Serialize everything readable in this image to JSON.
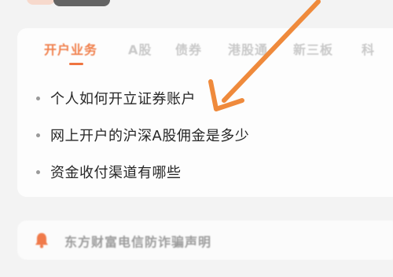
{
  "tabs": [
    {
      "label": "开户业务",
      "active": true
    },
    {
      "label": "A股",
      "active": false
    },
    {
      "label": "债券",
      "active": false
    },
    {
      "label": "港股通",
      "active": false
    },
    {
      "label": "新三板",
      "active": false
    },
    {
      "label": "科",
      "active": false
    }
  ],
  "faq": [
    {
      "label": "个人如何开立证券账户"
    },
    {
      "label": "网上开户的沪深A股佣金是多少"
    },
    {
      "label": "资金收付渠道有哪些"
    }
  ],
  "notice": {
    "label": "东方财富电信防诈骗声明",
    "icon": "bell-icon"
  },
  "annotation": {
    "icon": "arrow-icon",
    "color": "#ef8a3c"
  },
  "colors": {
    "accent": "#ef7440",
    "text": "#262626",
    "muted": "#c9c9c9"
  }
}
